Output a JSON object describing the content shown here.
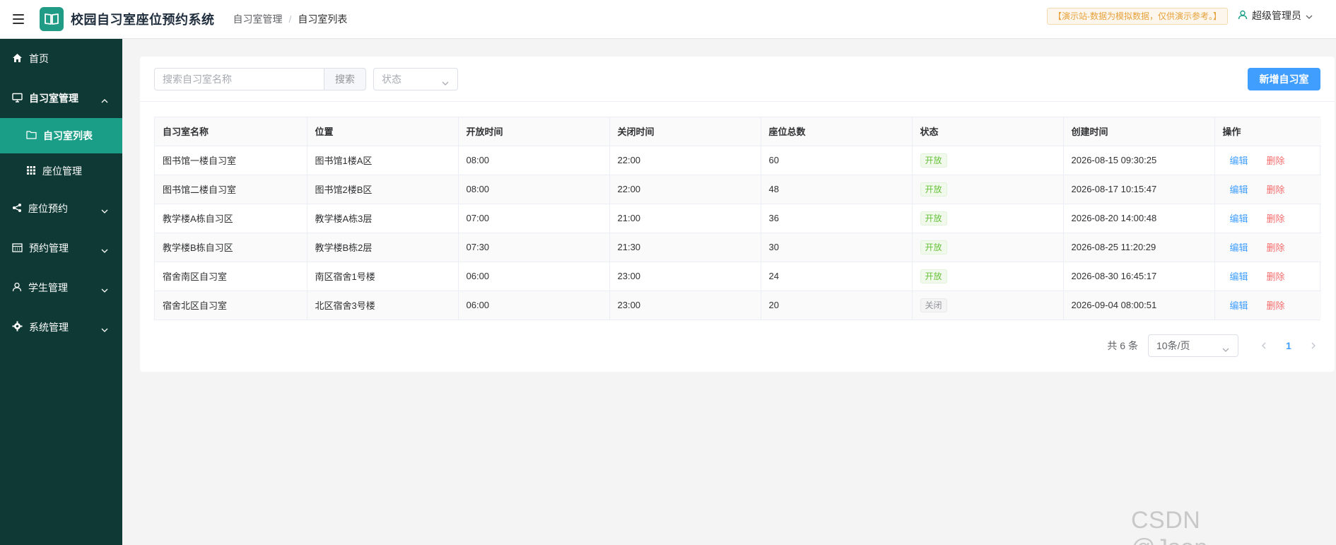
{
  "header": {
    "title": "校园自习室座位预约系统",
    "breadcrumb": [
      "自习室管理",
      "自习室列表"
    ],
    "breadcrumb_separator": "/",
    "demo_notice": "【演示站-数据为模拟数据，仅供演示参考。】",
    "user_label": "超级管理员"
  },
  "sidebar": {
    "items": [
      {
        "label": "首页",
        "icon": "home-icon"
      },
      {
        "label": "自习室管理",
        "icon": "monitor-icon",
        "expanded": true,
        "children": [
          {
            "label": "自习室列表",
            "icon": "folder-icon",
            "active": true
          },
          {
            "label": "座位管理",
            "icon": "grid-icon"
          }
        ]
      },
      {
        "label": "座位预约",
        "icon": "share-icon"
      },
      {
        "label": "预约管理",
        "icon": "calendar-icon"
      },
      {
        "label": "学生管理",
        "icon": "user-icon"
      },
      {
        "label": "系统管理",
        "icon": "gear-icon"
      }
    ]
  },
  "toolbar": {
    "search_placeholder": "搜索自习室名称",
    "search_button": "搜索",
    "status_placeholder": "状态",
    "add_button": "新增自习室"
  },
  "table": {
    "columns": [
      "自习室名称",
      "位置",
      "开放时间",
      "关闭时间",
      "座位总数",
      "状态",
      "创建时间",
      "操作"
    ],
    "rows": [
      {
        "name": "图书馆一楼自习室",
        "location": "图书馆1楼A区",
        "open": "08:00",
        "close": "22:00",
        "seats": "60",
        "status": "开放",
        "created": "2026-08-15 09:30:25"
      },
      {
        "name": "图书馆二楼自习室",
        "location": "图书馆2楼B区",
        "open": "08:00",
        "close": "22:00",
        "seats": "48",
        "status": "开放",
        "created": "2026-08-17 10:15:47"
      },
      {
        "name": "教学楼A栋自习区",
        "location": "教学楼A栋3层",
        "open": "07:00",
        "close": "21:00",
        "seats": "36",
        "status": "开放",
        "created": "2026-08-20 14:00:48"
      },
      {
        "name": "教学楼B栋自习区",
        "location": "教学楼B栋2层",
        "open": "07:30",
        "close": "21:30",
        "seats": "30",
        "status": "开放",
        "created": "2026-08-25 11:20:29"
      },
      {
        "name": "宿舍南区自习室",
        "location": "南区宿舍1号楼",
        "open": "06:00",
        "close": "23:00",
        "seats": "24",
        "status": "开放",
        "created": "2026-08-30 16:45:17"
      },
      {
        "name": "宿舍北区自习室",
        "location": "北区宿舍3号楼",
        "open": "06:00",
        "close": "23:00",
        "seats": "20",
        "status": "关闭",
        "created": "2026-09-04 08:00:51"
      }
    ],
    "edit_label": "编辑",
    "delete_label": "删除"
  },
  "pagination": {
    "total_text": "共 6 条",
    "page_size": "10条/页",
    "current_page": "1"
  },
  "watermark": "CSDN @Json_____",
  "colors": {
    "sidebar_bg": "#0e3934",
    "sidebar_active": "#1b9e87",
    "primary": "#409eff",
    "danger": "#f56c6c",
    "success": "#67c23a"
  }
}
